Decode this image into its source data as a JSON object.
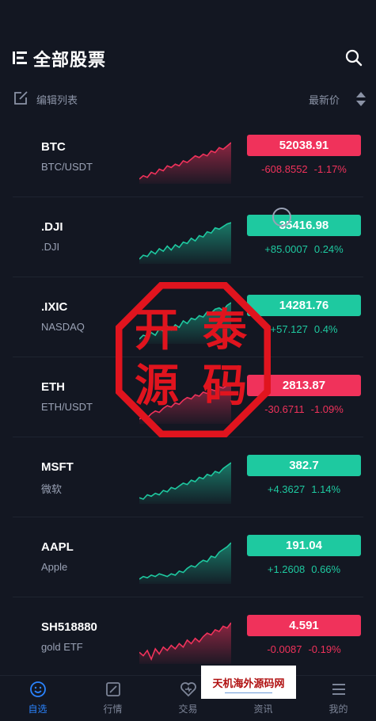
{
  "header": {
    "title": "全部股票"
  },
  "toolbar": {
    "edit_label": "编辑列表",
    "sort_label": "最新价"
  },
  "stocks": [
    {
      "symbol": "BTC",
      "name": "BTC/USDT",
      "price": "52038.91",
      "change": "-608.8552",
      "change_pct": "-1.17%",
      "direction": "down",
      "spark": [
        38,
        40,
        39,
        42,
        41,
        44,
        43,
        46,
        45,
        47,
        46,
        49,
        48,
        50,
        52,
        51,
        53,
        52,
        55,
        54,
        57,
        56,
        58,
        60
      ]
    },
    {
      "symbol": ".DJI",
      "name": ".DJI",
      "price": "35416.98",
      "change": "+85.0007",
      "change_pct": "0.24%",
      "direction": "up",
      "spark": [
        30,
        33,
        32,
        36,
        34,
        38,
        36,
        40,
        37,
        41,
        39,
        43,
        42,
        46,
        44,
        48,
        47,
        51,
        50,
        54,
        53,
        55,
        57,
        58
      ]
    },
    {
      "symbol": ".IXIC",
      "name": "NASDAQ",
      "price": "14281.76",
      "change": "+57.127",
      "change_pct": "0.4%",
      "direction": "up",
      "spark": [
        28,
        31,
        30,
        33,
        31,
        36,
        34,
        38,
        35,
        39,
        37,
        42,
        40,
        44,
        43,
        46,
        45,
        49,
        48,
        51,
        52,
        50,
        54,
        56
      ]
    },
    {
      "symbol": "ETH",
      "name": "ETH/USDT",
      "price": "2813.87",
      "change": "-30.6711",
      "change_pct": "-1.09%",
      "direction": "down",
      "spark": [
        30,
        32,
        31,
        34,
        36,
        35,
        38,
        40,
        39,
        42,
        41,
        44,
        46,
        45,
        48,
        47,
        50,
        49,
        52,
        51,
        54,
        53,
        55,
        57
      ]
    },
    {
      "symbol": "MSFT",
      "name": "微软",
      "price": "382.7",
      "change": "+4.3627",
      "change_pct": "1.14%",
      "direction": "up",
      "spark": [
        30,
        29,
        32,
        31,
        33,
        32,
        35,
        34,
        37,
        36,
        38,
        40,
        39,
        42,
        41,
        44,
        43,
        46,
        45,
        48,
        47,
        50,
        52,
        54
      ]
    },
    {
      "symbol": "AAPL",
      "name": "Apple",
      "price": "191.04",
      "change": "+1.2608",
      "change_pct": "0.66%",
      "direction": "up",
      "spark": [
        28,
        30,
        29,
        31,
        30,
        32,
        31,
        30,
        32,
        31,
        34,
        33,
        36,
        38,
        37,
        40,
        42,
        41,
        45,
        44,
        48,
        50,
        52,
        55
      ]
    },
    {
      "symbol": "SH518880",
      "name": "gold ETF",
      "price": "4.591",
      "change": "-0.0087",
      "change_pct": "-0.19%",
      "direction": "down",
      "spark": [
        30,
        28,
        31,
        26,
        32,
        29,
        33,
        31,
        34,
        32,
        35,
        33,
        37,
        35,
        38,
        36,
        39,
        41,
        40,
        43,
        42,
        45,
        44,
        47
      ]
    }
  ],
  "nav": [
    {
      "label": "自选",
      "icon": "smiley-icon",
      "active": true
    },
    {
      "label": "行情",
      "icon": "chart-edit-icon",
      "active": false
    },
    {
      "label": "交易",
      "icon": "heart-shield-icon",
      "active": false
    },
    {
      "label": "资讯",
      "icon": "news-icon",
      "active": false
    },
    {
      "label": "我的",
      "icon": "menu-lines-icon",
      "active": false
    }
  ],
  "watermark": {
    "stamp_text": [
      "开",
      "泰",
      "源",
      "码"
    ],
    "ad_text": "天机海外源码网"
  },
  "colors": {
    "up": "#1ec9a0",
    "down": "#f0325b",
    "active_nav": "#2a84ff",
    "background": "#131722"
  }
}
